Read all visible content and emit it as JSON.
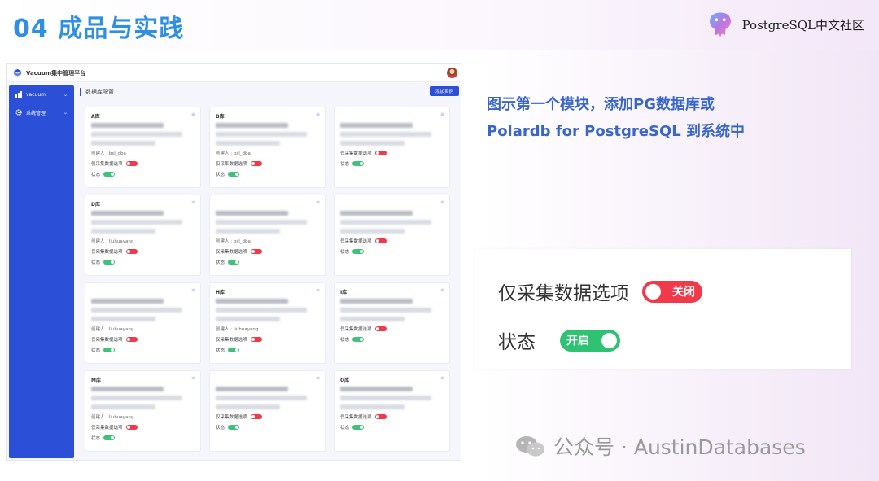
{
  "slide": {
    "title": "04 成品与实践",
    "brand": "PostgreSQL中文社区",
    "description_lines": [
      "图示第一个模块，添加PG数据库或",
      "Polardb for PostgreSQL 到系统中"
    ],
    "watermark": "公众号 · AustinDatabases"
  },
  "app": {
    "title": "Vacuum集中管理平台",
    "sidebar": [
      {
        "label": "vacuum",
        "icon": "chart-icon"
      },
      {
        "label": "系统管理",
        "icon": "gear-icon"
      }
    ],
    "section_title": "数据库配置",
    "add_button": "添加实例",
    "collect_label": "仅采集数据选项",
    "status_label": "状态",
    "owner_prefix": "创建人",
    "cards": [
      {
        "name": "A库",
        "owner": "创建人 : bsl_dba",
        "collect_on": false,
        "status_on": true
      },
      {
        "name": "B库",
        "owner": "创建人 : bsl_dba",
        "collect_on": false,
        "status_on": true
      },
      {
        "name": "",
        "owner": "",
        "collect_on": false,
        "status_on": true
      },
      {
        "name": "D库",
        "owner": "创建人 : liuhuayang",
        "collect_on": false,
        "status_on": true
      },
      {
        "name": "",
        "owner": "创建人 : bsl_dba",
        "collect_on": false,
        "status_on": true
      },
      {
        "name": "",
        "owner": "",
        "collect_on": false,
        "status_on": true
      },
      {
        "name": "",
        "owner": "创建人 : liuhuayang",
        "collect_on": false,
        "status_on": true
      },
      {
        "name": "H库",
        "owner": "创建人 : liuhuayang",
        "collect_on": false,
        "status_on": true
      },
      {
        "name": "I库",
        "owner": "",
        "collect_on": false,
        "status_on": true
      },
      {
        "name": "M库",
        "owner": "创建人 : liuhuayang",
        "collect_on": false,
        "status_on": true
      },
      {
        "name": "",
        "owner": "",
        "collect_on": false,
        "status_on": true
      },
      {
        "name": "O库",
        "owner": "",
        "collect_on": false,
        "status_on": true
      }
    ]
  },
  "zoom": {
    "collect_label": "仅采集数据选项",
    "collect_switch": "关闭",
    "status_label": "状态",
    "status_switch": "开启"
  },
  "colors": {
    "title": "#2f8fe0",
    "sidebar": "#2c4fd8",
    "off": "#f03a4a",
    "on": "#2fc272",
    "description": "#3a66c8"
  }
}
